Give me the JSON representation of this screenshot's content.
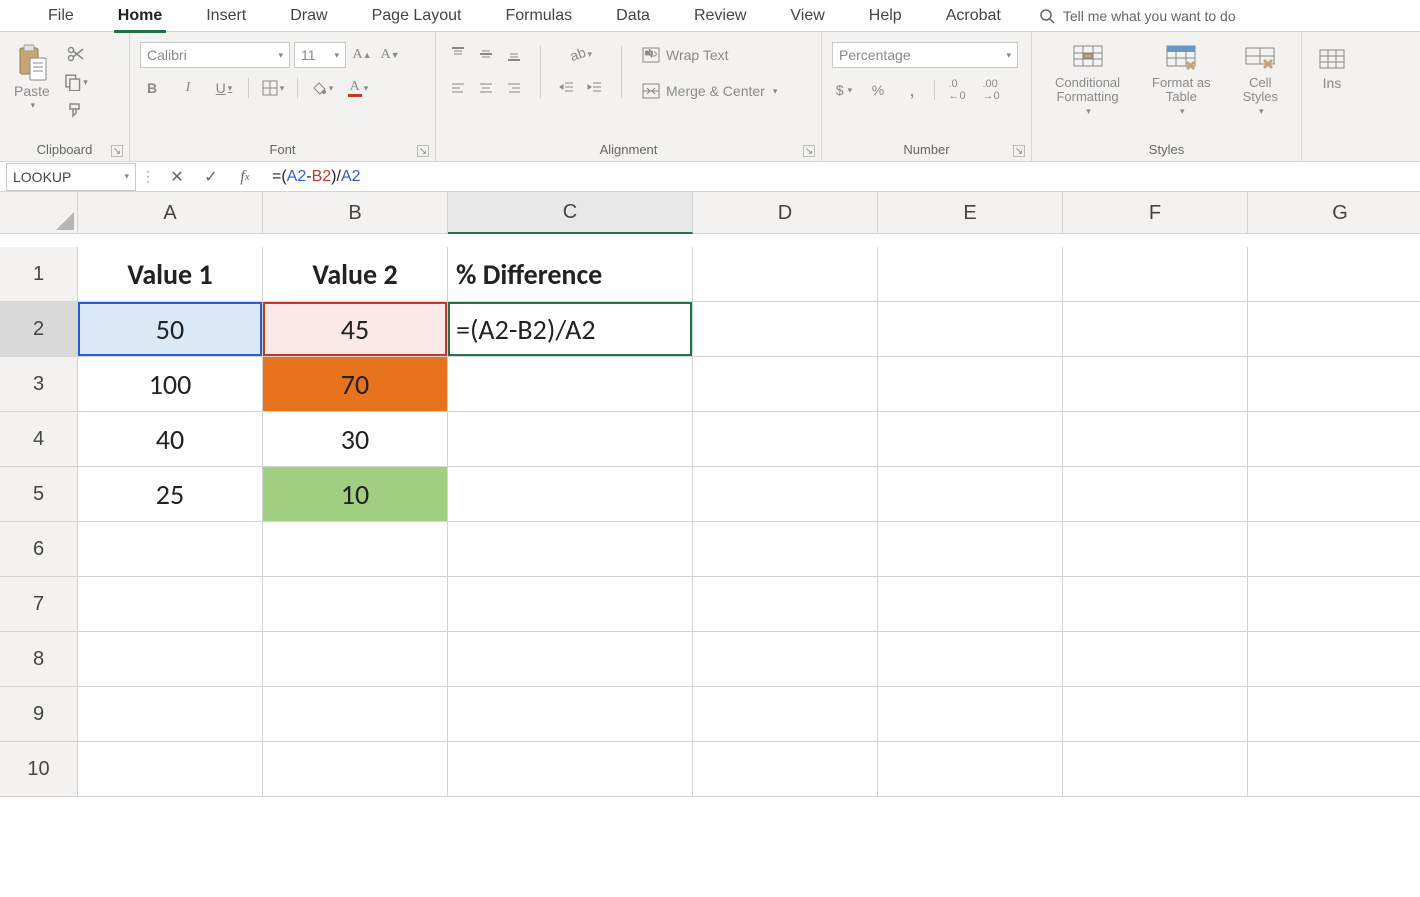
{
  "tabs": {
    "file": "File",
    "home": "Home",
    "insert": "Insert",
    "draw": "Draw",
    "page_layout": "Page Layout",
    "formulas": "Formulas",
    "data": "Data",
    "review": "Review",
    "view": "View",
    "help": "Help",
    "acrobat": "Acrobat",
    "tell_me": "Tell me what you want to do"
  },
  "ribbon": {
    "clipboard": {
      "paste": "Paste",
      "label": "Clipboard"
    },
    "font": {
      "name": "Calibri",
      "size": "11",
      "label": "Font"
    },
    "alignment": {
      "wrap": "Wrap Text",
      "merge": "Merge & Center",
      "label": "Alignment"
    },
    "number": {
      "format": "Percentage",
      "label": "Number"
    },
    "styles": {
      "cond": "Conditional\nFormatting",
      "fmt_table": "Format as\nTable",
      "cell_styles": "Cell\nStyles",
      "label": "Styles"
    },
    "ins": "Ins"
  },
  "formula_bar": {
    "name_box": "LOOKUP",
    "equals": "=",
    "open": "(",
    "ref1": "A2",
    "minus": "-",
    "ref2": "B2",
    "close": ")/",
    "ref3": "A2"
  },
  "grid": {
    "cols": [
      "A",
      "B",
      "C",
      "D",
      "E",
      "F",
      "G"
    ],
    "rows": [
      "1",
      "2",
      "3",
      "4",
      "5",
      "6",
      "7",
      "8",
      "9",
      "10"
    ],
    "headers": {
      "A1": "Value 1",
      "B1": "Value 2",
      "C1": "% Difference"
    },
    "data": {
      "A2": "50",
      "B2": "45",
      "A3": "100",
      "B3": "70",
      "A4": "40",
      "B4": "30",
      "A5": "25",
      "B5": "10"
    },
    "C2_formula": "=(A2-B2)/A2"
  }
}
